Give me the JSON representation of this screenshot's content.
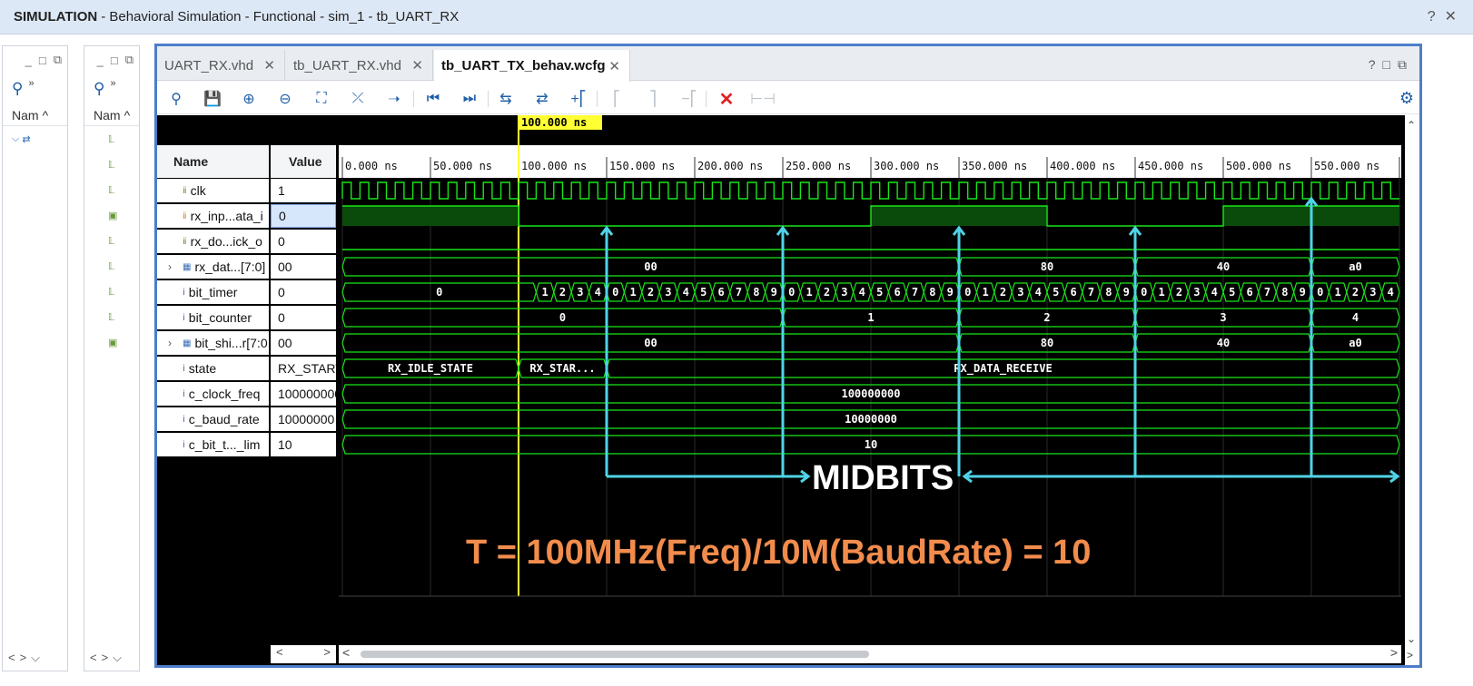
{
  "title_bar": {
    "mode": "SIMULATION",
    "rest": "- Behavioral Simulation - Functional - sim_1 - tb_UART_RX",
    "help": "?",
    "close": "✕"
  },
  "left_panel_1": {
    "col_header": "Nam"
  },
  "left_panel_2": {
    "col_header": "Nam"
  },
  "tabs": [
    {
      "label": "UART_RX.vhd"
    },
    {
      "label": "tb_UART_RX.vhd"
    },
    {
      "label": "tb_UART_TX_behav.wcfg"
    }
  ],
  "wave": {
    "name_header": "Name",
    "value_header": "Value",
    "cursor_label": "100.000 ns",
    "cursor_time_ns": 100,
    "time_ticks": [
      "0.000 ns",
      "50.000 ns",
      "100.000 ns",
      "150.000 ns",
      "200.000 ns",
      "250.000 ns",
      "300.000 ns",
      "350.000 ns",
      "400.000 ns",
      "450.000 ns",
      "500.000 ns",
      "550.000 ns",
      "6"
    ],
    "signals": [
      {
        "name": "clk",
        "value": "1",
        "icon": "signal-icon"
      },
      {
        "name": "rx_inp...ata_i",
        "value": "0",
        "icon": "input-signal-icon"
      },
      {
        "name": "rx_do...ick_o",
        "value": "0",
        "icon": "signal-icon"
      },
      {
        "name": "rx_dat...[7:0]",
        "value": "00",
        "icon": "bus-icon"
      },
      {
        "name": "bit_timer",
        "value": "0",
        "icon": "integer-icon"
      },
      {
        "name": "bit_counter",
        "value": "0",
        "icon": "integer-icon"
      },
      {
        "name": "bit_shi...r[7:0",
        "value": "00",
        "icon": "bus-icon"
      },
      {
        "name": "state",
        "value": "RX_START",
        "icon": "integer-icon"
      },
      {
        "name": "c_clock_freq",
        "value": "100000000",
        "icon": "constant-icon"
      },
      {
        "name": "c_baud_rate",
        "value": "10000000",
        "icon": "constant-icon"
      },
      {
        "name": "c_bit_t..._lim",
        "value": "10",
        "icon": "constant-icon"
      }
    ],
    "bus_values": {
      "rx_data": [
        "00",
        "80",
        "40",
        "a0"
      ],
      "bit_timer_idle": "0",
      "bit_timer_cycle": [
        "1",
        "2",
        "3",
        "4",
        "0",
        "1",
        "2",
        "3",
        "4",
        "5",
        "6",
        "7",
        "8",
        "9",
        "0",
        "1",
        "2",
        "3",
        "4",
        "5",
        "6",
        "7",
        "8",
        "9",
        "0",
        "1",
        "2",
        "3",
        "4",
        "5",
        "6",
        "7",
        "8",
        "9",
        "0",
        "1",
        "2",
        "3",
        "4",
        "5",
        "6",
        "7",
        "8",
        "9",
        "0",
        "1",
        "2",
        "3",
        "4"
      ],
      "bit_counter": [
        "0",
        "1",
        "2",
        "3",
        "4"
      ],
      "bit_shift": [
        "00",
        "80",
        "40",
        "a0"
      ],
      "state": [
        "RX_IDLE_STATE",
        "RX_STAR...",
        "RX_DATA_RECEIVE"
      ],
      "c_clock_freq": "100000000",
      "c_baud_rate": "10000000",
      "c_bit_timer_lim": "10"
    }
  },
  "annotations": {
    "midbits_label": "MIDBITS",
    "formula": "T = 100MHz(Freq)/10M(BaudRate) = 10",
    "arrow_color": "#4fd3e6",
    "formula_color": "#f28c4c"
  },
  "colors": {
    "wave_green": "#19e619",
    "bus_fill": "#0a4a0a",
    "cursor": "#ffff33"
  }
}
